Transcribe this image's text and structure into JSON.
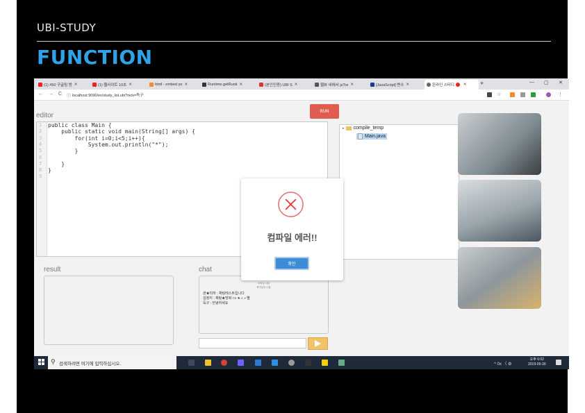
{
  "slide": {
    "brand": "UBI-STUDY",
    "heading": "FUNCTION"
  },
  "browser": {
    "tabs": [
      {
        "label": "(1) #50 구글링 방",
        "color": "#e22"
      },
      {
        "label": "(1) 웹사이트 10초",
        "color": "#e22"
      },
      {
        "label": "html - embed yo",
        "color": "#f28c28"
      },
      {
        "label": "Runtime.getRunti",
        "color": "#333"
      },
      {
        "label": "(본인인증) UBI S",
        "color": "#d33"
      },
      {
        "label": "웹뷰 내에서 jsTre",
        "color": "#555"
      },
      {
        "label": "[JavaScript] 변수",
        "color": "#1e3a8a"
      },
      {
        "label": "온라인 스터디",
        "color": "#666"
      }
    ],
    "new_tab": "+",
    "window_controls": [
      "—",
      "▢",
      "✕"
    ],
    "nav": [
      "←",
      "→",
      "C"
    ],
    "url": "localhost:9090/ex/study_list.ubi?nick=득구"
  },
  "ide": {
    "editor_label": "editor",
    "run_label": "RUN",
    "code_lines": [
      "public class Main {",
      "    public static void main(String[] args) {",
      "        for(int i=0;i<5;i++){",
      "            System.out.println(\"*\");",
      "        }",
      "",
      "    }",
      "}",
      ""
    ],
    "line_numbers": [
      "1",
      "2",
      "3",
      "4",
      "5",
      "6",
      "7",
      "8",
      "9"
    ],
    "tree": {
      "folder": "compile_temp",
      "file": "Main.java"
    },
    "result_label": "result",
    "chat_label": "chat",
    "chat_system": [
      "소리님 나감",
      "득구님이 나감"
    ],
    "chat_messages": [
      "관★리자 : 채팅테스트입니다",
      "김정지 : 채팅★방화 i o ★ㅅㅅ별",
      "득구 : 안녕하세요"
    ]
  },
  "modal": {
    "icon": "error-x-icon",
    "title": "컴파일 에러!!",
    "ok_label": "확인",
    "accent": "#e53935"
  },
  "taskbar": {
    "search_placeholder": "검색하려면 여기에 입력하십시오.",
    "time": "오후 6:02",
    "date": "2019-09-30",
    "tray": "^ 0x 〈 ⚙"
  }
}
